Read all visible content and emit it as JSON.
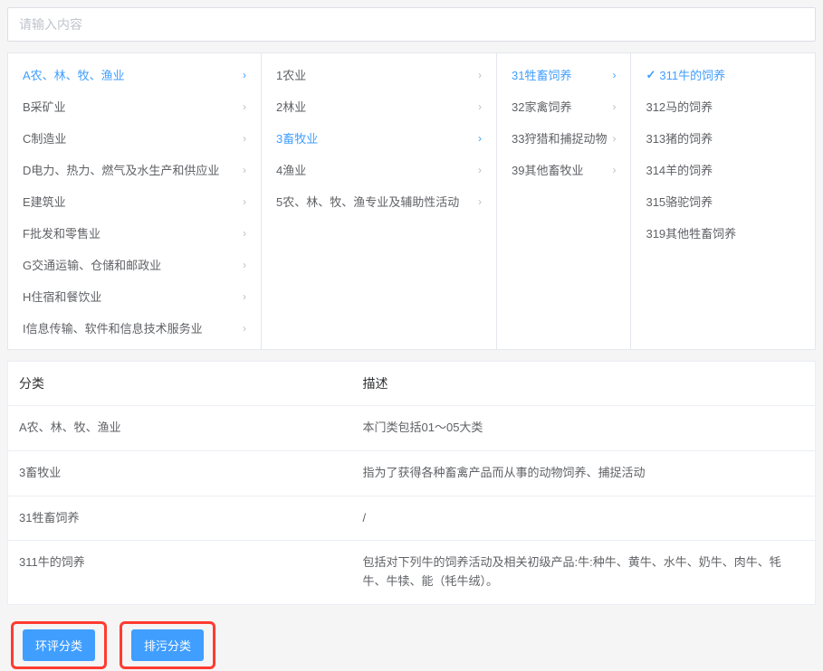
{
  "search": {
    "placeholder": "请输入内容"
  },
  "cascade": {
    "col1": [
      {
        "label": "A农、林、牧、渔业",
        "active": true
      },
      {
        "label": "B采矿业",
        "active": false
      },
      {
        "label": "C制造业",
        "active": false
      },
      {
        "label": "D电力、热力、燃气及水生产和供应业",
        "active": false
      },
      {
        "label": "E建筑业",
        "active": false
      },
      {
        "label": "F批发和零售业",
        "active": false
      },
      {
        "label": "G交通运输、仓储和邮政业",
        "active": false
      },
      {
        "label": "H住宿和餐饮业",
        "active": false
      },
      {
        "label": "I信息传输、软件和信息技术服务业",
        "active": false
      }
    ],
    "col2": [
      {
        "label": "1农业",
        "active": false
      },
      {
        "label": "2林业",
        "active": false
      },
      {
        "label": "3畜牧业",
        "active": true
      },
      {
        "label": "4渔业",
        "active": false
      },
      {
        "label": "5农、林、牧、渔专业及辅助性活动",
        "active": false
      }
    ],
    "col3": [
      {
        "label": "31牲畜饲养",
        "active": true
      },
      {
        "label": "32家禽饲养",
        "active": false
      },
      {
        "label": "33狩猎和捕捉动物",
        "active": false
      },
      {
        "label": "39其他畜牧业",
        "active": false
      }
    ],
    "col4": [
      {
        "label": "311牛的饲养",
        "active": true,
        "selected": true
      },
      {
        "label": "312马的饲养",
        "active": false
      },
      {
        "label": "313猪的饲养",
        "active": false
      },
      {
        "label": "314羊的饲养",
        "active": false
      },
      {
        "label": "315骆驼饲养",
        "active": false
      },
      {
        "label": "319其他牲畜饲养",
        "active": false
      }
    ]
  },
  "table": {
    "headers": {
      "cat": "分类",
      "desc": "描述"
    },
    "rows": [
      {
        "cat": "A农、林、牧、渔业",
        "desc": "本门类包括01～05大类"
      },
      {
        "cat": "3畜牧业",
        "desc": "指为了获得各种畜禽产品而从事的动物饲养、捕捉活动"
      },
      {
        "cat": "31牲畜饲养",
        "desc": "/"
      },
      {
        "cat": "311牛的饲养",
        "desc": "包括对下列牛的饲养活动及相关初级产品:牛:种牛、黄牛、水牛、奶牛、肉牛、牦牛、牛犊、能（牦牛绒）。"
      }
    ]
  },
  "buttons": {
    "eia": "环评分类",
    "emission": "排污分类"
  }
}
